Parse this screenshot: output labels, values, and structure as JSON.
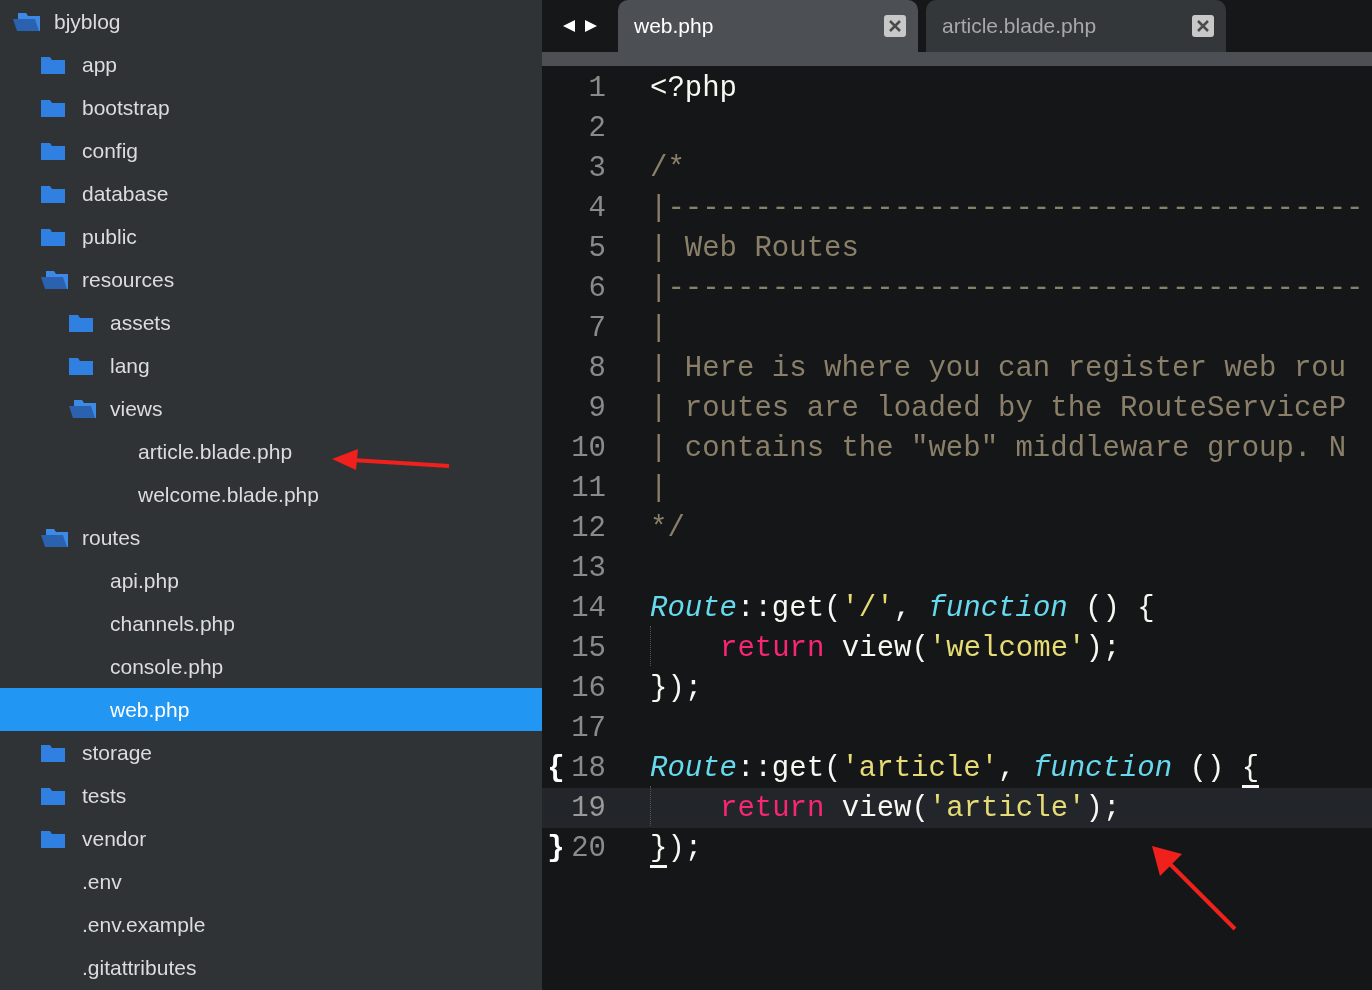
{
  "sidebar": {
    "tree": [
      {
        "name": "bjyblog",
        "kind": "folder",
        "expanded": true,
        "selected": false,
        "children": [
          {
            "name": "app",
            "kind": "folder",
            "expanded": false,
            "selected": false
          },
          {
            "name": "bootstrap",
            "kind": "folder",
            "expanded": false,
            "selected": false
          },
          {
            "name": "config",
            "kind": "folder",
            "expanded": false,
            "selected": false
          },
          {
            "name": "database",
            "kind": "folder",
            "expanded": false,
            "selected": false
          },
          {
            "name": "public",
            "kind": "folder",
            "expanded": false,
            "selected": false
          },
          {
            "name": "resources",
            "kind": "folder",
            "expanded": true,
            "selected": false,
            "children": [
              {
                "name": "assets",
                "kind": "folder",
                "expanded": false,
                "selected": false
              },
              {
                "name": "lang",
                "kind": "folder",
                "expanded": false,
                "selected": false
              },
              {
                "name": "views",
                "kind": "folder",
                "expanded": true,
                "selected": false,
                "children": [
                  {
                    "name": "article.blade.php",
                    "kind": "file",
                    "selected": false
                  },
                  {
                    "name": "welcome.blade.php",
                    "kind": "file",
                    "selected": false
                  }
                ]
              }
            ]
          },
          {
            "name": "routes",
            "kind": "folder",
            "expanded": true,
            "selected": false,
            "children": [
              {
                "name": "api.php",
                "kind": "file",
                "selected": false
              },
              {
                "name": "channels.php",
                "kind": "file",
                "selected": false
              },
              {
                "name": "console.php",
                "kind": "file",
                "selected": false
              },
              {
                "name": "web.php",
                "kind": "file",
                "selected": true
              }
            ]
          },
          {
            "name": "storage",
            "kind": "folder",
            "expanded": false,
            "selected": false
          },
          {
            "name": "tests",
            "kind": "folder",
            "expanded": false,
            "selected": false
          },
          {
            "name": "vendor",
            "kind": "folder",
            "expanded": false,
            "selected": false
          },
          {
            "name": ".env",
            "kind": "file",
            "selected": false
          },
          {
            "name": ".env.example",
            "kind": "file",
            "selected": false
          },
          {
            "name": ".gitattributes",
            "kind": "file",
            "selected": false
          }
        ]
      }
    ]
  },
  "tabs": [
    {
      "label": "web.php",
      "selected": true
    },
    {
      "label": "article.blade.php",
      "selected": false
    }
  ],
  "editor": {
    "lines": [
      {
        "number": "1",
        "current": false,
        "tokens": [
          {
            "text": "<?php",
            "kind": "plain"
          }
        ]
      },
      {
        "number": "2",
        "current": false
      },
      {
        "number": "3",
        "current": false,
        "tokens": [
          {
            "text": "/*",
            "kind": "comment"
          }
        ]
      },
      {
        "number": "4",
        "current": false,
        "tokens": [
          {
            "text": "|----------------------------------------",
            "kind": "comment"
          }
        ]
      },
      {
        "number": "5",
        "current": false,
        "tokens": [
          {
            "text": "| Web Routes",
            "kind": "comment"
          }
        ]
      },
      {
        "number": "6",
        "current": false,
        "tokens": [
          {
            "text": "|----------------------------------------",
            "kind": "comment"
          }
        ]
      },
      {
        "number": "7",
        "current": false,
        "tokens": [
          {
            "text": "|",
            "kind": "comment"
          }
        ]
      },
      {
        "number": "8",
        "current": false,
        "tokens": [
          {
            "text": "| Here is where you can register web rou",
            "kind": "comment"
          }
        ]
      },
      {
        "number": "9",
        "current": false,
        "tokens": [
          {
            "text": "| routes are loaded by the RouteServiceP",
            "kind": "comment"
          }
        ]
      },
      {
        "number": "10",
        "current": false,
        "tokens": [
          {
            "text": "| contains the \"web\" middleware group. N",
            "kind": "comment"
          }
        ]
      },
      {
        "number": "11",
        "current": false,
        "tokens": [
          {
            "text": "|",
            "kind": "comment"
          }
        ]
      },
      {
        "number": "12",
        "current": false,
        "tokens": [
          {
            "text": "*/",
            "kind": "comment"
          }
        ]
      },
      {
        "number": "13",
        "current": false
      },
      {
        "number": "14",
        "current": false,
        "tokens": [
          {
            "text": "Route",
            "kind": "class"
          },
          {
            "text": "::get(",
            "kind": "plain"
          },
          {
            "text": "'/'",
            "kind": "string"
          },
          {
            "text": ", ",
            "kind": "plain"
          },
          {
            "text": "function",
            "kind": "storage"
          },
          {
            "text": " () {",
            "kind": "plain"
          }
        ]
      },
      {
        "number": "15",
        "current": false,
        "guide": true,
        "tokens": [
          {
            "text": "return",
            "kind": "keyword"
          },
          {
            "text": " view(",
            "kind": "plain"
          },
          {
            "text": "'welcome'",
            "kind": "string"
          },
          {
            "text": ");",
            "kind": "plain"
          }
        ]
      },
      {
        "number": "16",
        "current": false,
        "tokens": [
          {
            "text": "});",
            "kind": "plain"
          }
        ]
      },
      {
        "number": "17",
        "current": false
      },
      {
        "number": "18",
        "current": false,
        "marker": "{",
        "tokens": [
          {
            "text": "Route",
            "kind": "class"
          },
          {
            "text": "::get(",
            "kind": "plain"
          },
          {
            "text": "'article'",
            "kind": "string"
          },
          {
            "text": ", ",
            "kind": "plain"
          },
          {
            "text": "function",
            "kind": "storage"
          },
          {
            "text": " () ",
            "kind": "plain"
          },
          {
            "text": "{",
            "kind": "bracket"
          }
        ]
      },
      {
        "number": "19",
        "current": true,
        "guide": true,
        "tokens": [
          {
            "text": "return",
            "kind": "keyword"
          },
          {
            "text": " view(",
            "kind": "plain"
          },
          {
            "text": "'article'",
            "kind": "string"
          },
          {
            "text": ");",
            "kind": "plain"
          }
        ]
      },
      {
        "number": "20",
        "current": false,
        "marker": "}",
        "tokens": [
          {
            "text": "}",
            "kind": "bracket"
          },
          {
            "text": ");",
            "kind": "plain"
          }
        ]
      }
    ]
  }
}
